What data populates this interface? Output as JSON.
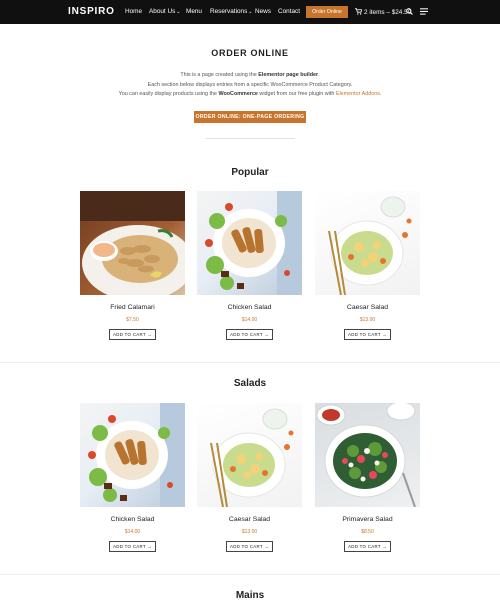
{
  "header": {
    "logo": "INSPIRO",
    "nav": [
      {
        "label": "Home",
        "chevron": false
      },
      {
        "label": "About Us",
        "chevron": true
      },
      {
        "label": "Menu",
        "chevron": false
      },
      {
        "label": "Reservations",
        "chevron": true
      },
      {
        "label": "News",
        "chevron": false
      },
      {
        "label": "Contact",
        "chevron": false
      }
    ],
    "order_button": "Order Online",
    "cart_label": "2 items – $24.50",
    "icons": [
      "cart-icon",
      "search-icon",
      "menu-icon"
    ]
  },
  "intro": {
    "title": "ORDER ONLINE",
    "line1_pre": "This is a page created using the ",
    "line1_bold": "Elementor page builder",
    "line1_post": ".",
    "line2": "Each section below displays entries from a specific WooCommerce Product Category.",
    "line3_pre": "You can easily display products using the ",
    "line3_bold": "WooCommerce",
    "line3_mid": " widget from our free plugin with ",
    "line3_link": "Elementor Addons",
    "line3_post": ".",
    "cta": "ORDER ONLINE: ONE-PAGE ORDERING"
  },
  "sections": [
    {
      "title": "Popular",
      "products": [
        {
          "name": "Fried Calamari",
          "price": "$7.50",
          "button": "ADD TO CART →"
        },
        {
          "name": "Chicken Salad",
          "price": "$14.00",
          "button": "ADD TO CART →"
        },
        {
          "name": "Caesar Salad",
          "price": "$13.00",
          "button": "ADD TO CART →"
        }
      ]
    },
    {
      "title": "Salads",
      "products": [
        {
          "name": "Chicken Salad",
          "price": "$14.00",
          "button": "ADD TO CART →"
        },
        {
          "name": "Caesar Salad",
          "price": "$13.00",
          "button": "ADD TO CART →"
        },
        {
          "name": "Primavera Salad",
          "price": "$8.50",
          "button": "ADD TO CART →"
        }
      ]
    },
    {
      "title": "Mains",
      "products": []
    }
  ],
  "colors": {
    "accent": "#c9742c",
    "header_bg": "#101010",
    "text": "#222222"
  }
}
